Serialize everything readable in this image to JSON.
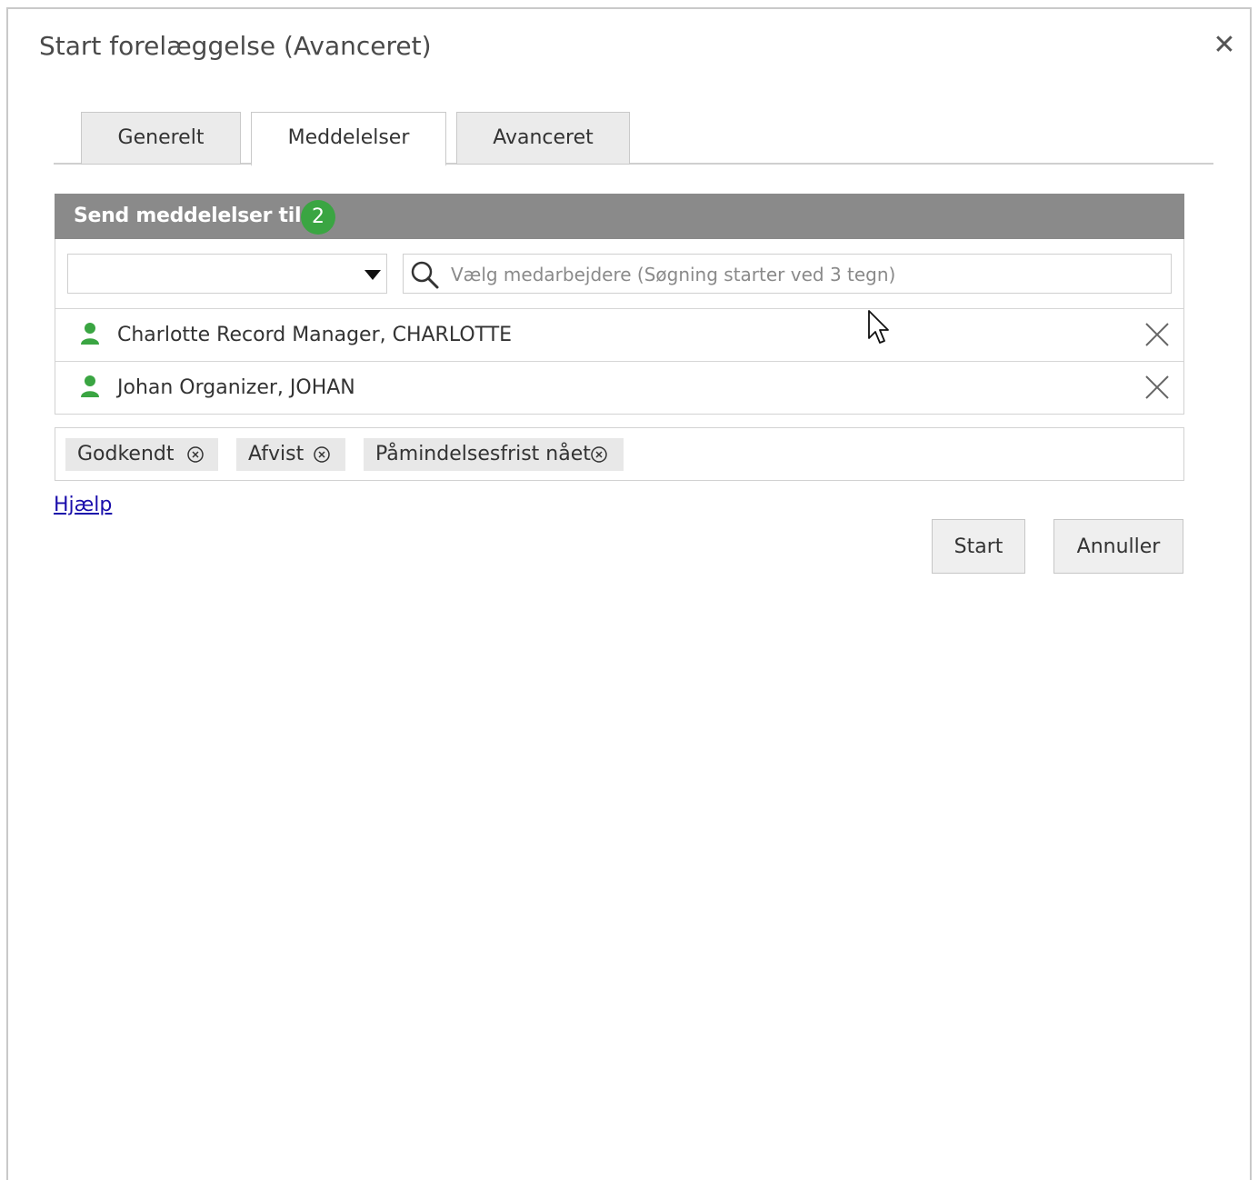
{
  "dialog": {
    "title": "Start forelæggelse (Avanceret)",
    "close_icon": "close-icon"
  },
  "tabs": [
    {
      "label": "Generelt",
      "active": false
    },
    {
      "label": "Meddelelser",
      "active": true
    },
    {
      "label": "Avanceret",
      "active": false
    }
  ],
  "recipients_panel": {
    "header_label": "Send meddelelser til",
    "count": "2",
    "count_color": "#3aa542",
    "header_color": "#8a8a8a",
    "selector": {
      "value": ""
    },
    "search": {
      "placeholder": "Vælg medarbejdere (Søgning starter ved 3 tegn)",
      "value": ""
    },
    "recipients": [
      {
        "name": "Charlotte Record Manager, CHARLOTTE",
        "icon": "person-icon",
        "icon_color": "#3aa542"
      },
      {
        "name": "Johan Organizer, JOHAN",
        "icon": "person-icon",
        "icon_color": "#3aa542"
      }
    ]
  },
  "statuses": [
    {
      "label": "Godkendt"
    },
    {
      "label": "Afvist"
    },
    {
      "label": "Påmindelsesfrist nået"
    }
  ],
  "help_link": "Hjælp",
  "buttons": {
    "start": "Start",
    "cancel": "Annuller"
  }
}
